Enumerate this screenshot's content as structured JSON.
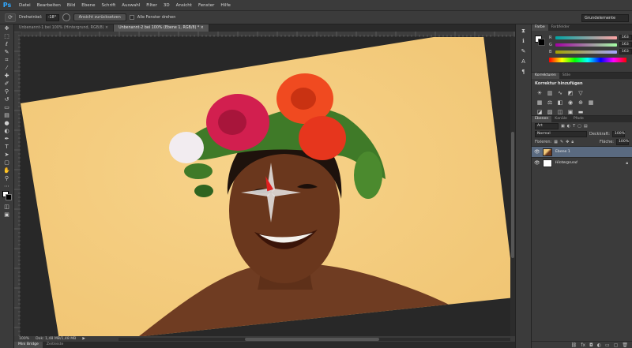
{
  "app": {
    "logo": "Ps"
  },
  "menu": [
    "Datei",
    "Bearbeiten",
    "Bild",
    "Ebene",
    "Schrift",
    "Auswahl",
    "Filter",
    "3D",
    "Ansicht",
    "Fenster",
    "Hilfe"
  ],
  "options": {
    "rotation_label": "Drehwinkel:",
    "rotation_value": "-18°",
    "reset_button": "Ansicht zurücksetzen",
    "rotate_all_label": "Alle Fenster drehen",
    "workspace": "Grundelemente"
  },
  "tabs": [
    {
      "label": "Unbenannt-1 bei 100% (Hintergrund, RGB/8) ×",
      "active": false
    },
    {
      "label": "Unbenannt-2 bei 100% (Ebene 1, RGB/8) * ×",
      "active": true
    }
  ],
  "status": {
    "zoom": "100%",
    "doc": "Dok: 1,48 MB/1,48 MB"
  },
  "bottom_tabs": [
    {
      "label": "Mini Bridge",
      "active": true
    },
    {
      "label": "Zeitleiste",
      "active": false
    }
  ],
  "color_panel": {
    "tabs": [
      {
        "label": "Farbe",
        "active": true
      },
      {
        "label": "Farbfelder",
        "active": false
      }
    ],
    "sliders": [
      {
        "letter": "R",
        "value": "163",
        "gradient": "linear-gradient(90deg,#00a3a3,#ffa3a3)"
      },
      {
        "letter": "G",
        "value": "163",
        "gradient": "linear-gradient(90deg,#a300a3,#a3ffa3)"
      },
      {
        "letter": "B",
        "value": "163",
        "gradient": "linear-gradient(90deg,#a3a300,#a3a3ff)"
      }
    ]
  },
  "adjust_panel": {
    "tabs": [
      {
        "label": "Korrekturen",
        "active": true
      },
      {
        "label": "Stile",
        "active": false
      }
    ],
    "title": "Korrektur hinzufügen"
  },
  "layers_panel": {
    "tabs": [
      {
        "label": "Ebenen",
        "active": true
      },
      {
        "label": "Kanäle",
        "active": false
      },
      {
        "label": "Pfade",
        "active": false
      }
    ],
    "kind_label": "Art",
    "blend_mode": "Normal",
    "opacity_label": "Deckkraft:",
    "opacity_value": "100%",
    "lock_label": "Fixieren:",
    "fill_label": "Fläche:",
    "fill_value": "100%",
    "layers": [
      {
        "name": "Ebene 1",
        "active": true
      },
      {
        "name": "Hintergrund",
        "active": false
      }
    ]
  }
}
